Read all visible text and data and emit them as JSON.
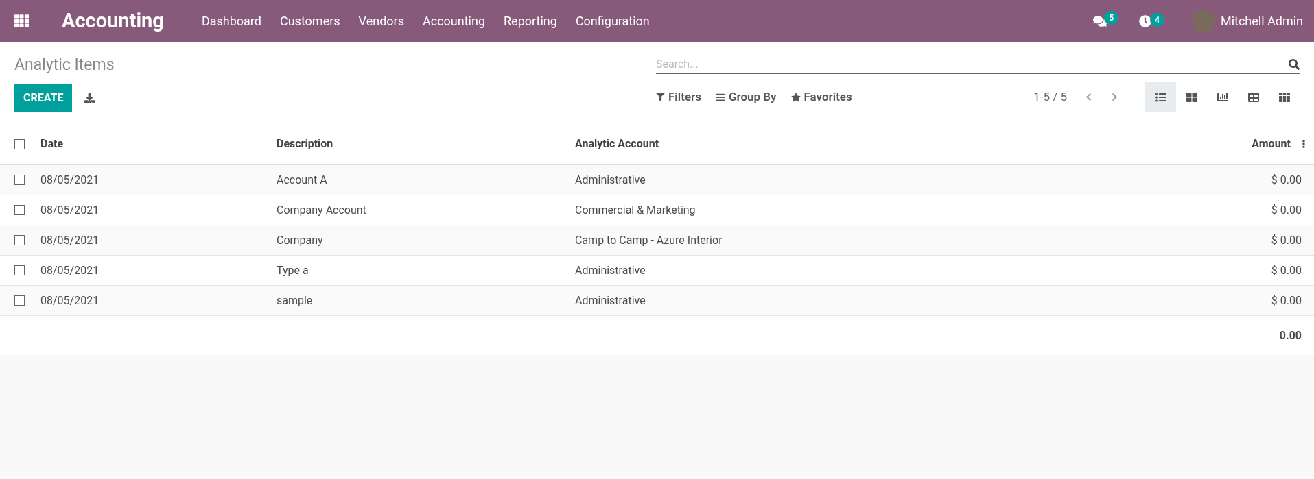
{
  "navbar": {
    "app_title": "Accounting",
    "menu": [
      "Dashboard",
      "Customers",
      "Vendors",
      "Accounting",
      "Reporting",
      "Configuration"
    ],
    "messages_count": "5",
    "activities_count": "4",
    "user": "Mitchell Admin"
  },
  "control_panel": {
    "breadcrumb": "Analytic Items",
    "create_button": "CREATE",
    "search": {
      "placeholder": "Search..."
    },
    "filters": [
      "Filters",
      "Group By",
      "Favorites"
    ],
    "pager": "1-5 / 5",
    "views": [
      {
        "kind": "list",
        "selected": true
      },
      {
        "kind": "kanban",
        "selected": false
      },
      {
        "kind": "graph",
        "selected": false
      },
      {
        "kind": "pivot",
        "selected": false
      },
      {
        "kind": "grid",
        "selected": false
      }
    ]
  },
  "table": {
    "select_all_checked": false,
    "columns": [
      "Date",
      "Description",
      "Analytic Account",
      "Amount"
    ],
    "rows": [
      {
        "checked": false,
        "cells": [
          "08/05/2021",
          "Account A",
          "Administrative",
          "$ 0.00"
        ]
      },
      {
        "checked": false,
        "cells": [
          "08/05/2021",
          "Company Account",
          "Commercial & Marketing",
          "$ 0.00"
        ]
      },
      {
        "checked": false,
        "cells": [
          "08/05/2021",
          "Company",
          "Camp to Camp - Azure Interior",
          "$ 0.00"
        ]
      },
      {
        "checked": false,
        "cells": [
          "08/05/2021",
          "Type a",
          "Administrative",
          "$ 0.00"
        ]
      },
      {
        "checked": false,
        "cells": [
          "08/05/2021",
          "sample",
          "Administrative",
          "$ 0.00"
        ]
      }
    ],
    "total": "0.00"
  }
}
